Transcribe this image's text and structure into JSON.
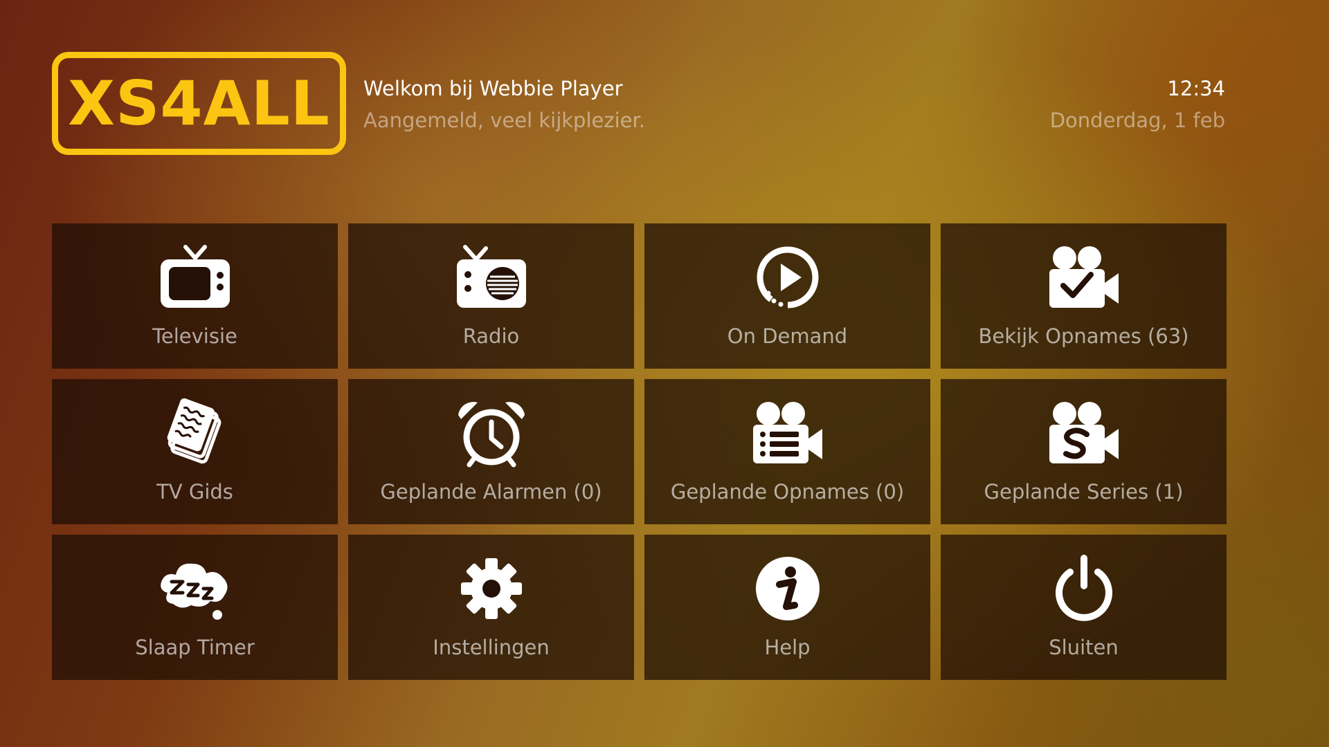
{
  "logo": {
    "text": "XS4ALL"
  },
  "header": {
    "title": "Welkom bij Webbie Player",
    "subtitle": "Aangemeld, veel kijkplezier.",
    "time": "12:34",
    "date": "Donderdag, 1 feb"
  },
  "colors": {
    "brand": "#fcc512",
    "tile_bg": "#1c0c04",
    "label": "#ffffff"
  },
  "menu": {
    "items": [
      {
        "label": "Televisie",
        "icon": "tv-icon"
      },
      {
        "label": "Radio",
        "icon": "radio-icon"
      },
      {
        "label": "On Demand",
        "icon": "replay-play-icon"
      },
      {
        "label": "Bekijk Opnames (63)",
        "icon": "camera-check-icon"
      },
      {
        "label": "TV Gids",
        "icon": "newspaper-icon"
      },
      {
        "label": "Geplande Alarmen (0)",
        "icon": "alarm-clock-icon"
      },
      {
        "label": "Geplande Opnames (0)",
        "icon": "camera-list-icon"
      },
      {
        "label": "Geplande Series (1)",
        "icon": "camera-series-icon"
      },
      {
        "label": "Slaap Timer",
        "icon": "sleep-icon"
      },
      {
        "label": "Instellingen",
        "icon": "gear-icon"
      },
      {
        "label": "Help",
        "icon": "info-icon"
      },
      {
        "label": "Sluiten",
        "icon": "power-icon"
      }
    ]
  }
}
